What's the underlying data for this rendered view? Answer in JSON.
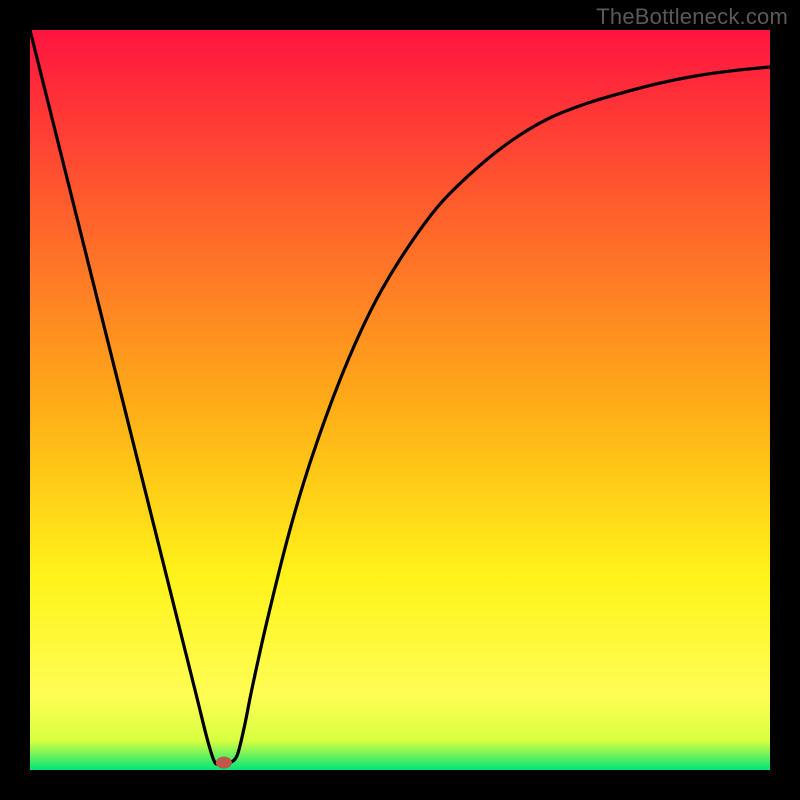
{
  "watermark": "TheBottleneck.com",
  "colors": {
    "frame": "#000000",
    "gradient_top": "#ff143f",
    "gradient_upper_mid": "#ff6a2a",
    "gradient_mid": "#ffb017",
    "gradient_lower_mid": "#fff31a",
    "gradient_near_bottom": "#d9ff40",
    "gradient_bottom": "#00e57a",
    "curve": "#000000",
    "marker_fill": "#c1564a",
    "marker_stroke": "#8e3f36"
  },
  "chart_data": {
    "type": "line",
    "title": "",
    "xlabel": "",
    "ylabel": "",
    "xlim": [
      0,
      1
    ],
    "ylim": [
      0,
      1
    ],
    "curve": [
      {
        "x": 0.0,
        "y": 1.0
      },
      {
        "x": 0.025,
        "y": 0.9
      },
      {
        "x": 0.05,
        "y": 0.8
      },
      {
        "x": 0.075,
        "y": 0.7
      },
      {
        "x": 0.1,
        "y": 0.6
      },
      {
        "x": 0.125,
        "y": 0.5
      },
      {
        "x": 0.15,
        "y": 0.4
      },
      {
        "x": 0.175,
        "y": 0.3
      },
      {
        "x": 0.2,
        "y": 0.2
      },
      {
        "x": 0.225,
        "y": 0.1
      },
      {
        "x": 0.24,
        "y": 0.04
      },
      {
        "x": 0.25,
        "y": 0.01
      },
      {
        "x": 0.26,
        "y": 0.01
      },
      {
        "x": 0.27,
        "y": 0.01
      },
      {
        "x": 0.28,
        "y": 0.02
      },
      {
        "x": 0.29,
        "y": 0.06
      },
      {
        "x": 0.3,
        "y": 0.11
      },
      {
        "x": 0.32,
        "y": 0.2
      },
      {
        "x": 0.35,
        "y": 0.32
      },
      {
        "x": 0.38,
        "y": 0.42
      },
      {
        "x": 0.42,
        "y": 0.53
      },
      {
        "x": 0.46,
        "y": 0.62
      },
      {
        "x": 0.5,
        "y": 0.69
      },
      {
        "x": 0.55,
        "y": 0.76
      },
      {
        "x": 0.6,
        "y": 0.81
      },
      {
        "x": 0.65,
        "y": 0.85
      },
      {
        "x": 0.7,
        "y": 0.88
      },
      {
        "x": 0.75,
        "y": 0.9
      },
      {
        "x": 0.8,
        "y": 0.915
      },
      {
        "x": 0.85,
        "y": 0.928
      },
      {
        "x": 0.9,
        "y": 0.938
      },
      {
        "x": 0.95,
        "y": 0.945
      },
      {
        "x": 1.0,
        "y": 0.95
      }
    ],
    "marker": {
      "x": 0.262,
      "y": 0.01
    }
  }
}
